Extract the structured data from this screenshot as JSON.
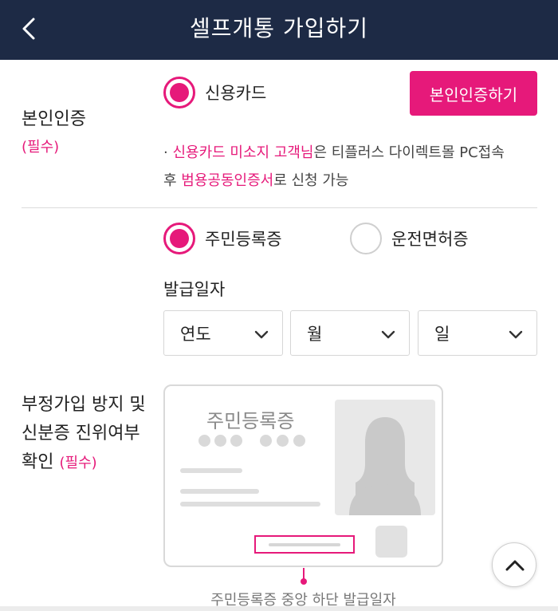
{
  "header": {
    "title": "셀프개통 가입하기",
    "back_icon": "chevron-left-icon"
  },
  "identity": {
    "label": "본인인증",
    "required": "(필수)",
    "method_credit_card": "신용카드",
    "auth_button": "본인인증하기",
    "note_bullet": "· ",
    "note_highlight_1": "신용카드 미소지 고객님",
    "note_text_1": "은 티플러스 다이렉트몰 PC접속",
    "note_text_2": "후 ",
    "note_highlight_2": "범용공동인증서",
    "note_text_3": "로 신청 가능"
  },
  "verification": {
    "label_line1": "부정가입 방지 및",
    "label_line2": "신분증 진위여부",
    "label_line3": "확인",
    "required": "(필수)",
    "id_types": {
      "resident_card": "주민등록증",
      "driver_license": "운전면허증"
    },
    "selected_id_type": "resident_card",
    "issue_date_label": "발급일자",
    "year_placeholder": "연도",
    "month_placeholder": "월",
    "day_placeholder": "일",
    "card_title": "주민등록증",
    "card_caption": "주민등록증 중앙 하단 발급일자"
  },
  "colors": {
    "accent": "#e6197a",
    "header_bg": "#1d2a45"
  }
}
